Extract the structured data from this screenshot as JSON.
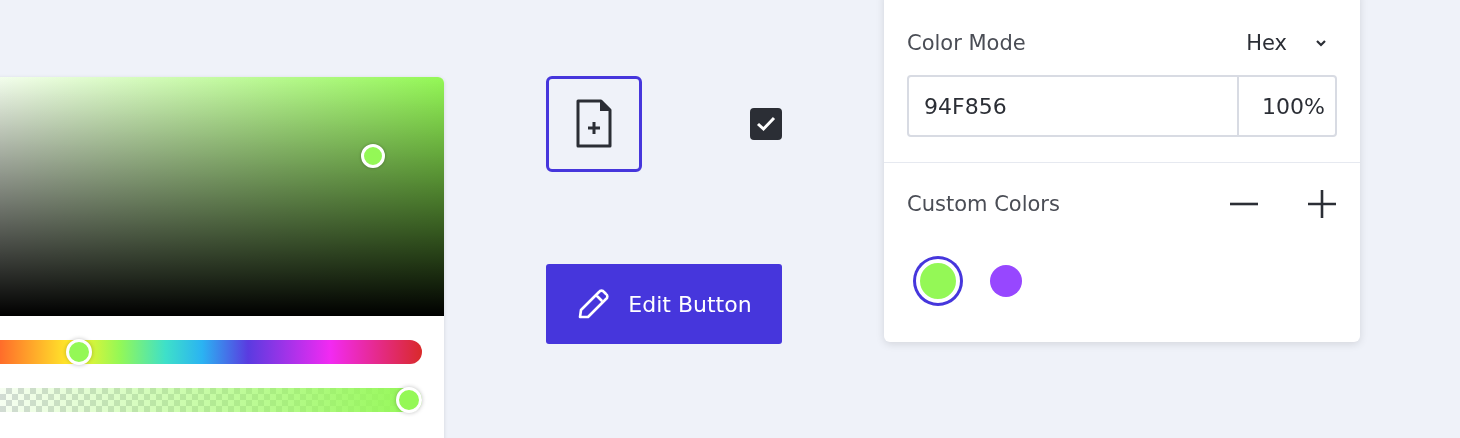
{
  "picker": {
    "color": "#94f856",
    "hue_slider": {
      "level": 0.24
    },
    "alpha_slider": {
      "level": 1
    }
  },
  "icon_button": {
    "selected": true
  },
  "checkbox": {
    "checked": true
  },
  "edit_button": {
    "label": "Edit Button"
  },
  "color_panel": {
    "mode_label": "Color Mode",
    "mode_value": "Hex",
    "hex_value": "94F856",
    "alpha_value": "100%",
    "custom_label": "Custom Colors",
    "swatches": [
      {
        "color": "#94f856",
        "selected": true
      },
      {
        "color": "#9747ff",
        "selected": false
      }
    ]
  }
}
